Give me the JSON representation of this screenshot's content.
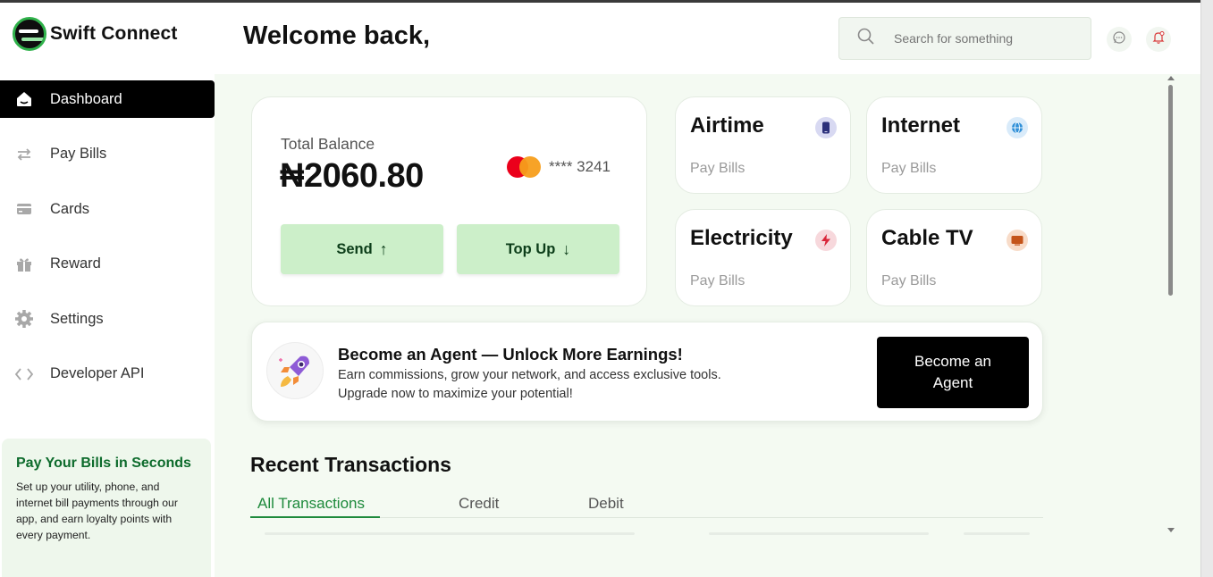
{
  "brand": {
    "name": "Swift Connect"
  },
  "sidebar": {
    "items": [
      {
        "label": "Dashboard",
        "icon": "home-icon",
        "active": true
      },
      {
        "label": "Pay Bills",
        "icon": "transfer-icon"
      },
      {
        "label": "Cards",
        "icon": "card-icon"
      },
      {
        "label": "Reward",
        "icon": "gift-icon"
      },
      {
        "label": "Settings",
        "icon": "gear-icon"
      },
      {
        "label": "Developer API",
        "icon": "code-icon"
      }
    ],
    "promo": {
      "title": "Pay Your Bills in Seconds",
      "text": "Set up your utility, phone, and internet bill payments through our app, and earn loyalty points with every payment."
    }
  },
  "header": {
    "welcome": "Welcome back,",
    "search_placeholder": "Search for something"
  },
  "balance": {
    "label": "Total Balance",
    "amount": "₦2060.80",
    "card_masked": "**** 3241",
    "send_label": "Send",
    "topup_label": "Top Up"
  },
  "services": [
    {
      "title": "Airtime",
      "subtitle": "Pay Bills",
      "icon": "phone-icon",
      "color": "#3a3f9e"
    },
    {
      "title": "Internet",
      "subtitle": "Pay Bills",
      "icon": "globe-icon",
      "color": "#2f8fd8"
    },
    {
      "title": "Electricity",
      "subtitle": "Pay Bills",
      "icon": "bolt-icon",
      "color": "#d9263a"
    },
    {
      "title": "Cable TV",
      "subtitle": "Pay Bills",
      "icon": "tv-icon",
      "color": "#c4541a"
    }
  ],
  "agent": {
    "title": "Become an Agent — Unlock More Earnings!",
    "description": "Earn commissions, grow your network, and access exclusive tools. Upgrade now to maximize your potential!",
    "button": "Become an Agent"
  },
  "transactions": {
    "title": "Recent Transactions",
    "tabs": [
      "All Transactions",
      "Credit",
      "Debit"
    ],
    "active_tab": "All Transactions"
  },
  "colors": {
    "accent": "#1e8a3c",
    "action_button": "#ccefc9",
    "background": "#f4faf2"
  }
}
